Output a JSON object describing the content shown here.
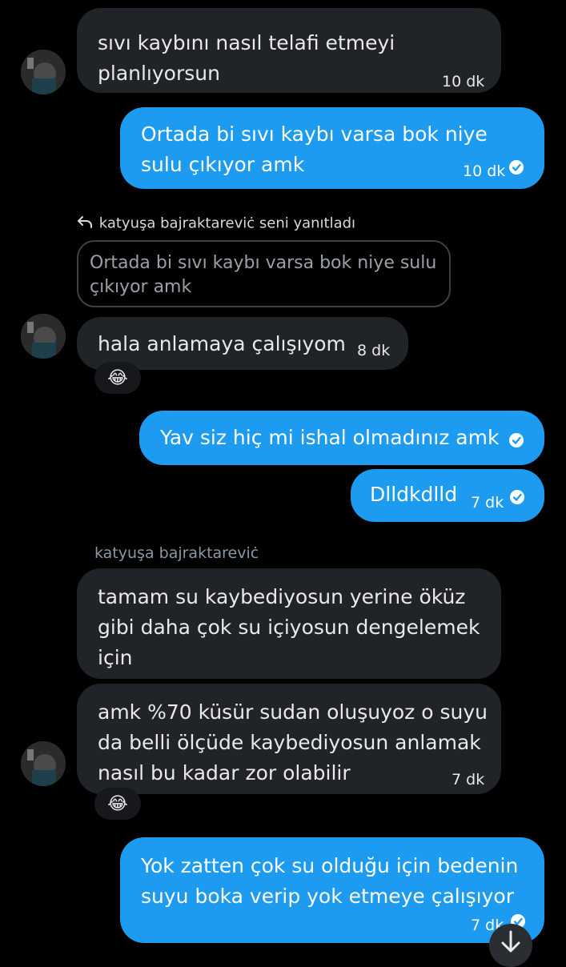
{
  "messages": [
    {
      "lines": [
        "sıvı kaybını nasıl telafi etmeyi",
        "planlıyorsun"
      ],
      "time": "10 dk"
    },
    {
      "lines": [
        "Ortada bi sıvı kaybı varsa bok niye",
        "sulu çıkıyor amk"
      ],
      "time": "10 dk"
    },
    {
      "reply_header": "katyuşa bajraktareviċ seni yanıtladı",
      "quoted_lines": [
        "Ortada bi sıvı kaybı varsa bok niye sulu",
        "çıkıyor amk"
      ]
    },
    {
      "lines": [
        "hala anlamaya çalışıyom"
      ],
      "time": "8 dk",
      "reaction": "😂"
    },
    {
      "lines": [
        "Yav siz hiç mi ishal olmadınız amk"
      ]
    },
    {
      "lines": [
        "Dlldkdlld"
      ],
      "time": "7 dk"
    },
    {
      "sender": "katyuşa bajraktareviċ"
    },
    {
      "lines": [
        "tamam su kaybediyosun yerine öküz",
        "gibi daha çok su içiyosun dengelemek",
        "için"
      ]
    },
    {
      "lines": [
        "amk %70 küsür sudan oluşuyoz o suyu",
        "da belli ölçüde kaybediyosun anlamak",
        "nasıl bu kadar zor olabilir"
      ],
      "time": "7 dk",
      "reaction": "😂"
    },
    {
      "lines": [
        "Yok zatten çok su olduğu için bedenin",
        "suyu boka verip yok etmeye çalışıyor"
      ],
      "time": "7 dk"
    }
  ],
  "icons": {
    "reply": "reply-arrow-icon",
    "read": "check-circle-icon",
    "scroll": "arrow-down-icon"
  }
}
